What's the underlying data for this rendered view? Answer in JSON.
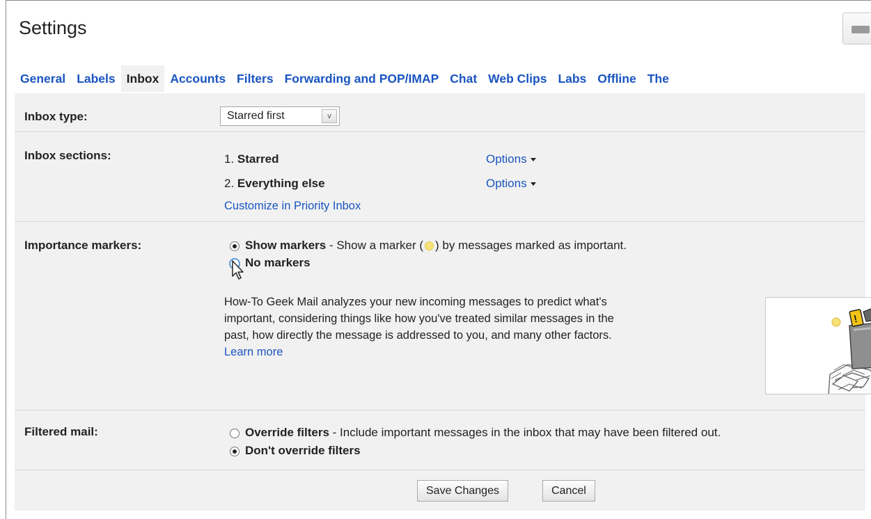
{
  "header": {
    "title": "Settings"
  },
  "tabs": [
    {
      "label": "General"
    },
    {
      "label": "Labels"
    },
    {
      "label": "Inbox",
      "active": true
    },
    {
      "label": "Accounts"
    },
    {
      "label": "Filters"
    },
    {
      "label": "Forwarding and POP/IMAP"
    },
    {
      "label": "Chat"
    },
    {
      "label": "Web Clips"
    },
    {
      "label": "Labs"
    },
    {
      "label": "Offline"
    },
    {
      "label": "The"
    }
  ],
  "inbox_type": {
    "label": "Inbox type:",
    "selected": "Starred first",
    "arrow": "v"
  },
  "inbox_sections": {
    "label": "Inbox sections:",
    "items": [
      {
        "number": "1.",
        "name": "Starred",
        "options": "Options"
      },
      {
        "number": "2.",
        "name": "Everything else",
        "options": "Options"
      }
    ],
    "customize_link": "Customize in Priority Inbox"
  },
  "importance": {
    "label": "Importance markers:",
    "show_title": "Show markers",
    "show_desc_pre": " - Show a marker (",
    "show_desc_post": ") by messages marked as important.",
    "no_title": "No markers",
    "description": "How-To Geek Mail analyzes your new incoming messages to predict what's important, considering things like how you've treated similar messages in the past, how directly the message is addressed to you, and many other factors.",
    "desc_lines": [
      "How-To Geek Mail analyzes your new incoming messages to predict what's",
      "important, considering things like how you've treated similar messages in the",
      "past, how directly the message is addressed to you, and many other factors."
    ],
    "learn_more": "Learn more",
    "selected": "Show markers"
  },
  "filtered": {
    "label": "Filtered mail:",
    "override_title": "Override filters",
    "override_desc": " - Include important messages in the inbox that may have been filtered out.",
    "dont_title": "Don't override filters",
    "selected": "Don't override filters"
  },
  "actions": {
    "save": "Save Changes",
    "cancel": "Cancel"
  },
  "colors": {
    "link": "#1a55c0",
    "panel": "#f1f1f1",
    "marker": "#f7e27a"
  }
}
